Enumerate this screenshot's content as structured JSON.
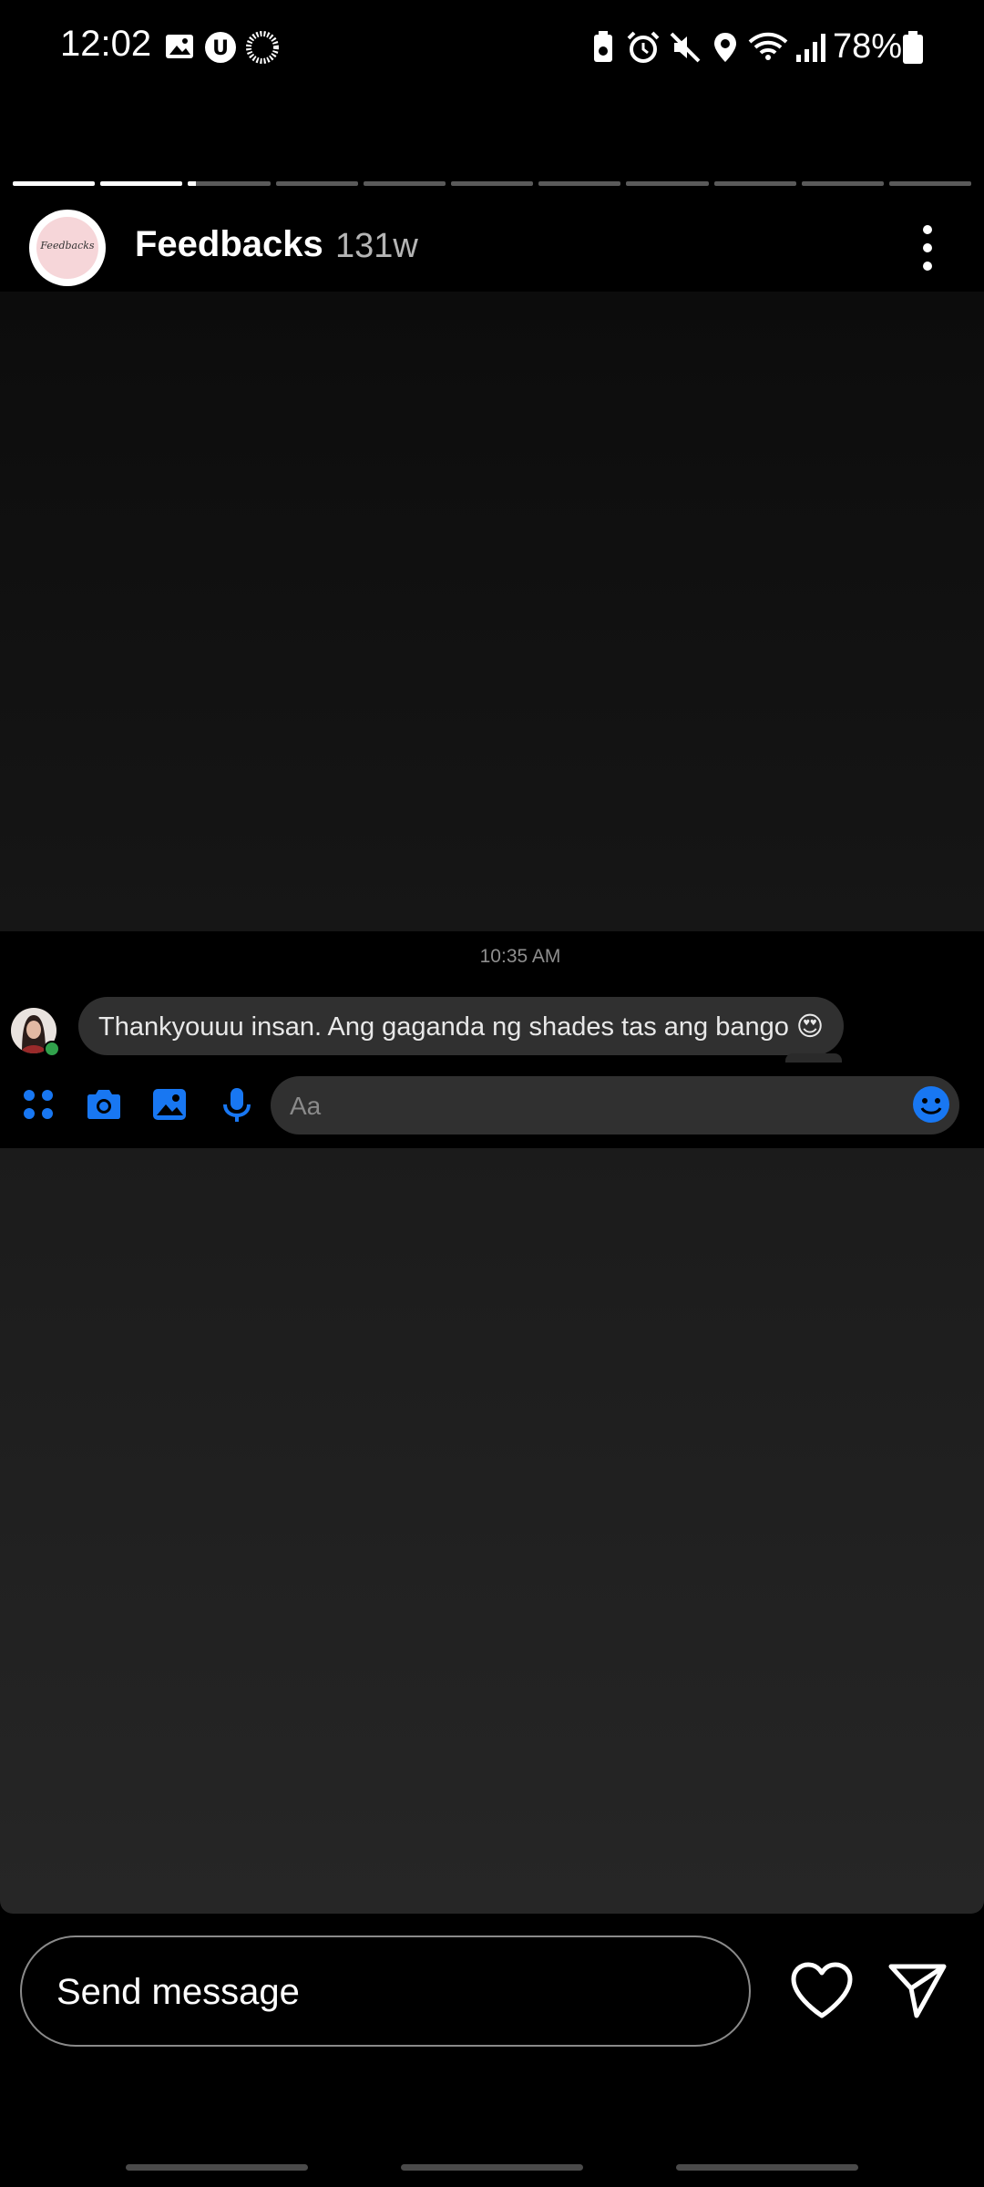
{
  "status_bar": {
    "time": "12:02",
    "battery": "78%",
    "icons": [
      "gallery-icon",
      "u-app-icon",
      "sync-icon",
      "battery-saver-icon",
      "alarm-icon",
      "mute-icon",
      "location-icon",
      "wifi-icon",
      "signal-icon",
      "battery-icon"
    ]
  },
  "story": {
    "progress_segments": [
      1,
      1,
      0.1,
      0,
      0,
      0,
      0,
      0,
      0,
      0,
      0
    ],
    "account_name": "Feedbacks",
    "age": "131w",
    "avatar_text": "Feedbacks"
  },
  "embedded_chat": {
    "timestamp": "10:35 AM",
    "message": "Thankyouuu insan. Ang gaganda ng shades tas ang bango 😍",
    "input_placeholder": "Aa",
    "accent_color": "#1877f2"
  },
  "bottom_bar": {
    "send_placeholder": "Send message"
  }
}
